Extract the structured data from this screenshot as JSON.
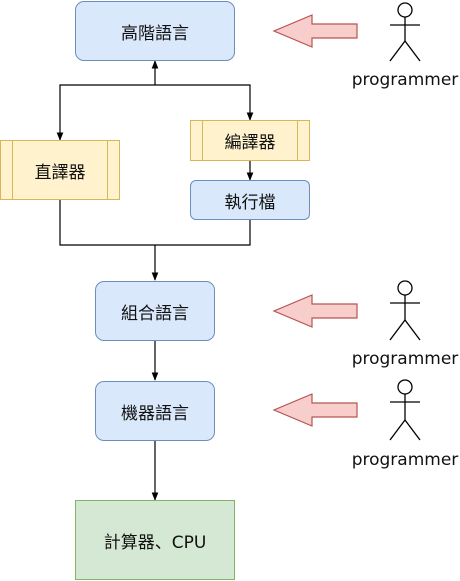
{
  "nodes": {
    "high_level": "高階語言",
    "interpreter": "直譯器",
    "compiler": "編譯器",
    "executable": "執行檔",
    "assembly": "組合語言",
    "machine": "機器語言",
    "computer": "計算器、CPU"
  },
  "actors": [
    {
      "label": "programmer"
    },
    {
      "label": "programmer"
    },
    {
      "label": "programmer"
    }
  ],
  "colors": {
    "lang_fill": "#dae8fc",
    "lang_stroke": "#6c8ebf",
    "proc_fill": "#fff2cc",
    "proc_stroke": "#d6b656",
    "hw_fill": "#d5e8d4",
    "hw_stroke": "#82b366",
    "arrow_fill": "#f8cecc",
    "arrow_stroke": "#b85450"
  }
}
